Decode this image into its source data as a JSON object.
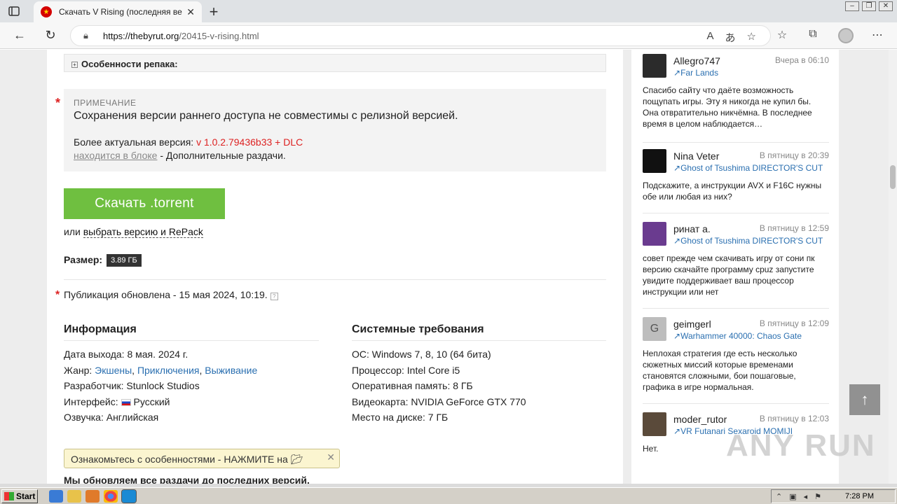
{
  "browser": {
    "tab_title": "Скачать V Rising (последняя вер",
    "url_host": "https://thebyrut.org",
    "url_path": "/20415-v-rising.html"
  },
  "page": {
    "spoiler_title": "Особенности репака:",
    "note_label": "ПРИМЕЧАНИЕ",
    "note_text": "Сохранения версии раннего доступа не совместимы с релизной версией.",
    "actual_prefix": "Более актуальная версия:",
    "actual_version": "v 1.0.2.79436b33 + DLC",
    "located_link": "находится в блоке",
    "located_suffix": " - Дополнительные раздачи.",
    "download_button": "Скачать .torrent",
    "or_prefix": "или ",
    "or_link": "выбрать версию и RePack",
    "size_label": "Размер:",
    "size_value": "3.89 ГБ",
    "published": "Публикация обновлена - 15 мая 2024, 10:19.",
    "info_title": "Информация",
    "sys_title": "Системные требования",
    "info": {
      "release_label": "Дата выхода:",
      "release_value": "8 мая. 2024 г.",
      "genre_label": "Жанр:",
      "genres": [
        "Экшены",
        "Приключения",
        "Выживание"
      ],
      "dev_label": "Разработчик:",
      "dev_value": "Stunlock Studios",
      "ui_label": "Интерфейс:",
      "ui_value": "Русский",
      "voice_label": "Озвучка:",
      "voice_value": "Английская"
    },
    "sys": {
      "os_label": "ОС:",
      "os_value": "Windows 7, 8, 10 (64 бита)",
      "cpu_label": "Процессор:",
      "cpu_value": "Intel Core i5",
      "ram_label": "Оперативная память:",
      "ram_value": "8 ГБ",
      "gpu_label": "Видеокарта:",
      "gpu_value": "NVIDIA GeForce GTX 770",
      "disk_label": "Место на диске:",
      "disk_value": "7 ГБ"
    },
    "features_banner": "Ознакомьтесь с особенностями - НАЖМИТЕ на",
    "bottom_text": "Мы обновляем все раздачи до последних версий."
  },
  "comments": [
    {
      "name": "Allegro747",
      "time": "Вчера в 06:10",
      "game": "Far Lands",
      "text": "Спасибо сайту что даёте возможность пощупать игры. Эту я никогда не купил бы. Она отвратительно никчёмна. В последнее время в целом наблюдается…",
      "avatar_color": "#2b2b2b"
    },
    {
      "name": "Nina Veter",
      "time": "В пятницу в 20:39",
      "game": "Ghost of Tsushima DIRECTOR'S CUT",
      "text": "Подскажите, а инструкции AVX и F16C нужны обе или любая из них?",
      "avatar_color": "#111111"
    },
    {
      "name": "ринат а.",
      "time": "В пятницу в 12:59",
      "game": "Ghost of Tsushima DIRECTOR'S CUT",
      "text": "совет прежде чем скачивать игру от сони пк версию скачайте программу cpuz запустите увидите поддерживает ваш процессор инструкции или нет",
      "avatar_color": "#6a3b8f"
    },
    {
      "name": "geimgerl",
      "time": "В пятницу в 12:09",
      "game": "Warhammer 40000: Chaos Gate",
      "text": "Неплохая стратегия где есть несколько сюжетных миссий которые временами становятся сложными, бои пошаговые, графика в игре нормальная.",
      "avatar_color": "#bdbdbd",
      "avatar_letter": "G"
    },
    {
      "name": "moder_rutor",
      "time": "В пятницу в 12:03",
      "game": "VR Futanari Sexaroid MOMIJI",
      "text": "Нет.",
      "avatar_color": "#5a4a3a"
    }
  ],
  "watermark": "ANY RUN",
  "taskbar": {
    "start": "Start",
    "clock": "7:28 PM"
  }
}
